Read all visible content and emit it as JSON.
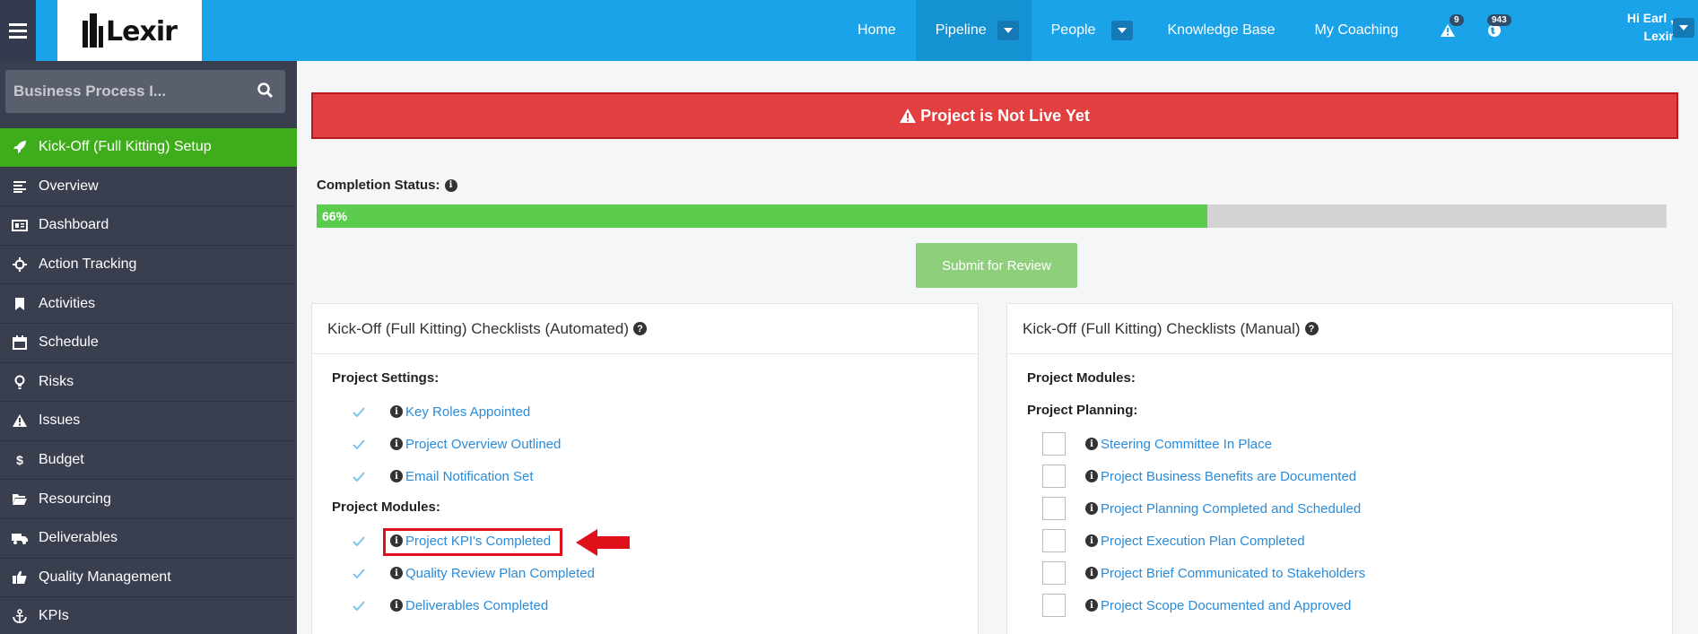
{
  "header": {
    "logo_text": "Lexir",
    "nav": [
      {
        "label": "Home"
      },
      {
        "label": "Pipeline"
      },
      {
        "label": "People"
      },
      {
        "label": "Knowledge Base"
      },
      {
        "label": "My Coaching"
      }
    ],
    "alerts_count": "9",
    "messages_count": "943",
    "user_greeting": "Hi Earl ,",
    "user_name": "Lexir"
  },
  "sidebar": {
    "search_placeholder": "Business Process I...",
    "items": [
      {
        "label": "Kick-Off (Full Kitting) Setup",
        "icon": "rocket-icon"
      },
      {
        "label": "Overview",
        "icon": "list-icon"
      },
      {
        "label": "Dashboard",
        "icon": "dashboard-icon"
      },
      {
        "label": "Action Tracking",
        "icon": "crosshair-icon"
      },
      {
        "label": "Activities",
        "icon": "bookmark-icon"
      },
      {
        "label": "Schedule",
        "icon": "calendar-icon"
      },
      {
        "label": "Risks",
        "icon": "lightbulb-icon"
      },
      {
        "label": "Issues",
        "icon": "warning-icon"
      },
      {
        "label": "Budget",
        "icon": "dollar-icon"
      },
      {
        "label": "Resourcing",
        "icon": "folder-icon"
      },
      {
        "label": "Deliverables",
        "icon": "truck-icon"
      },
      {
        "label": "Quality Management",
        "icon": "thumbs-up-icon"
      },
      {
        "label": "KPIs",
        "icon": "anchor-icon"
      }
    ]
  },
  "main": {
    "alert_text": "Project is Not Live Yet",
    "completion_label": "Completion Status:",
    "completion_percent": 66,
    "completion_text": "66%",
    "submit_label": "Submit for Review",
    "automated": {
      "title": "Kick-Off (Full Kitting) Checklists (Automated)",
      "sections": [
        {
          "title": "Project Settings:",
          "items": [
            {
              "label": "Key Roles Appointed",
              "checked": true
            },
            {
              "label": "Project Overview Outlined",
              "checked": true
            },
            {
              "label": "Email Notification Set",
              "checked": true
            }
          ]
        },
        {
          "title": "Project Modules:",
          "items": [
            {
              "label": "Project KPI's Completed",
              "checked": true
            },
            {
              "label": "Quality Review Plan Completed",
              "checked": true
            },
            {
              "label": "Deliverables Completed",
              "checked": true
            }
          ]
        }
      ]
    },
    "manual": {
      "title": "Kick-Off (Full Kitting) Checklists (Manual)",
      "sections": [
        {
          "title": "Project Modules:",
          "items": []
        },
        {
          "title": "Project Planning:",
          "items": [
            {
              "label": "Steering Committee In Place",
              "checked": false
            },
            {
              "label": "Project Business Benefits are Documented",
              "checked": false
            },
            {
              "label": "Project Planning Completed and Scheduled",
              "checked": false
            },
            {
              "label": "Project Execution Plan Completed",
              "checked": false
            },
            {
              "label": "Project Brief Communicated to Stakeholders",
              "checked": false
            },
            {
              "label": "Project Scope Documented and Approved",
              "checked": false
            }
          ]
        }
      ]
    }
  },
  "colors": {
    "topbar": "#1aa3e8",
    "sidebar": "#3a3f4f",
    "active_sidebar": "#3fad1b",
    "alert": "#e24040",
    "progress": "#5ccc4f",
    "link": "#2a8bd8"
  }
}
